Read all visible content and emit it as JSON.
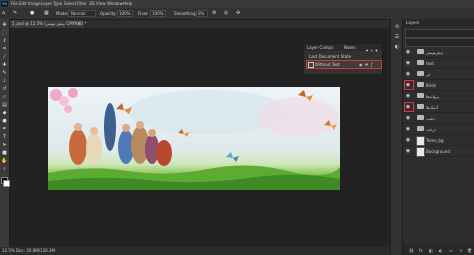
{
  "menubar": {
    "app_logo": "Ps",
    "items": [
      "File",
      "Edit",
      "Image",
      "Layer",
      "Type",
      "Select",
      "Filter",
      "3D",
      "View",
      "Window",
      "Help"
    ],
    "window_controls": [
      "—",
      "❐",
      "✕"
    ]
  },
  "options": {
    "mode_label": "Mode:",
    "mode_value": "Normal",
    "opacity_label": "Opacity:",
    "opacity_value": "100%",
    "flow_label": "Flow:",
    "flow_value": "100%",
    "smoothing_label": "Smoothing:",
    "smoothing_value": "0%"
  },
  "document": {
    "tab_title": "5_psd @ 12.5% (پیش نویس, CMYK/8) *",
    "close_glyph": "×",
    "status": "12.5%    Doc: 20.8M/120.3M"
  },
  "tools": [
    "move-icon",
    "marquee-icon",
    "lasso-icon",
    "crop-icon",
    "eyedropper-icon",
    "healing-icon",
    "brush-icon",
    "stamp-icon",
    "history-brush-icon",
    "eraser-icon",
    "gradient-icon",
    "blur-icon",
    "dodge-icon",
    "pen-icon",
    "type-icon",
    "path-select-icon",
    "shape-icon",
    "hand-icon",
    "zoom-icon"
  ],
  "layer_comps": {
    "tabs": [
      "Layer Comps",
      "Notes"
    ],
    "last_state": "Last Document State",
    "comp_name": "Without Text"
  },
  "layers_panel": {
    "title": "Layers",
    "layers": [
      {
        "name": "پیش‌نویس",
        "type": "folder"
      },
      {
        "name": "text",
        "type": "folder"
      },
      {
        "name": "ابر",
        "type": "folder"
      },
      {
        "name": "Birds",
        "type": "folder"
      },
      {
        "name": "پروانه‌ها",
        "type": "folder"
      },
      {
        "name": "آدمک‌ها",
        "type": "folder"
      },
      {
        "name": "دشت",
        "type": "folder"
      },
      {
        "name": "درخت",
        "type": "folder"
      },
      {
        "name": "Trees_bg",
        "type": "layer"
      },
      {
        "name": "Background",
        "type": "layer"
      }
    ]
  },
  "colors": {
    "highlight": "#e0333a",
    "accent": "#31a8ff"
  }
}
